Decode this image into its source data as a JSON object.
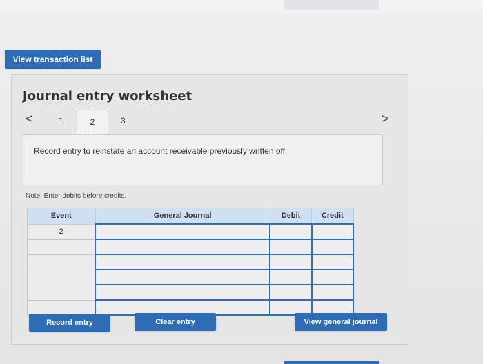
{
  "toolbar": {
    "view_transactions_label": "View transaction list"
  },
  "worksheet": {
    "title": "Journal entry worksheet",
    "pages": [
      "1",
      "2",
      "3"
    ],
    "current_page": "2",
    "nav_prev": "<",
    "nav_next": ">",
    "description": "Record entry to reinstate an account receivable previously written off.",
    "note": "Note: Enter debits before credits.",
    "table": {
      "headers": {
        "event": "Event",
        "general_journal": "General Journal",
        "debit": "Debit",
        "credit": "Credit"
      },
      "rows": [
        {
          "event": "2",
          "account": "",
          "debit": "",
          "credit": ""
        },
        {
          "event": "",
          "account": "",
          "debit": "",
          "credit": ""
        },
        {
          "event": "",
          "account": "",
          "debit": "",
          "credit": ""
        },
        {
          "event": "",
          "account": "",
          "debit": "",
          "credit": ""
        },
        {
          "event": "",
          "account": "",
          "debit": "",
          "credit": ""
        },
        {
          "event": "",
          "account": "",
          "debit": "",
          "credit": ""
        }
      ]
    },
    "buttons": {
      "record": "Record entry",
      "clear": "Clear entry",
      "view_general": "View general journal"
    }
  },
  "colors": {
    "accent": "#2e6db3",
    "table_header": "#cfe0f2"
  }
}
